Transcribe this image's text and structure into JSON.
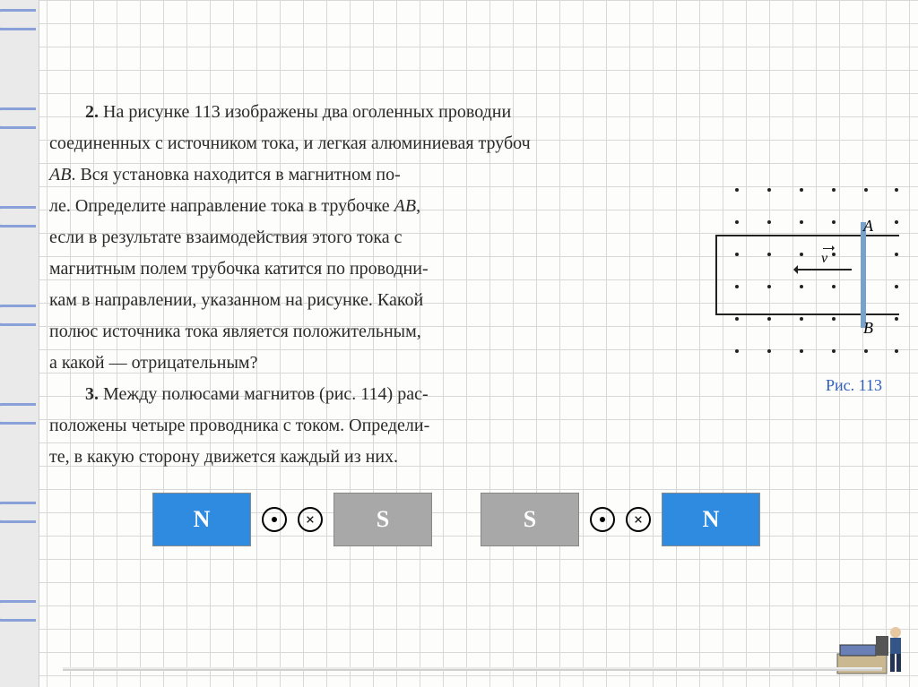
{
  "problems": {
    "p2": {
      "num": "2.",
      "t1": "На рисунке 113 изображены два оголенных проводни",
      "t2": "соединенных с источником тока, и легкая алюминиевая трубоч",
      "t3a": "AB",
      "t3b": ". Вся установка находится в магнитном по-",
      "t4a": "ле. Определите направление тока в трубочке ",
      "t4b": "AB",
      "t4c": ",",
      "t5": "если в результате взаимодействия этого тока с",
      "t6": "магнитным полем трубочка катится по проводни-",
      "t7": "кам в направлении, указанном на рисунке. Какой",
      "t8": "полюс источника тока является положительным,",
      "t9": "а какой — отрицательным?"
    },
    "p3": {
      "num": "3.",
      "t1": "Между полюсами магнитов (рис. 114) рас-",
      "t2": "положены четыре проводника с током. Определи-",
      "t3": "те, в какую сторону движется каждый из них."
    }
  },
  "fig113": {
    "A": "A",
    "B": "B",
    "v": "v",
    "caption": "Рис. 113"
  },
  "fig114": {
    "N": "N",
    "S": "S"
  }
}
